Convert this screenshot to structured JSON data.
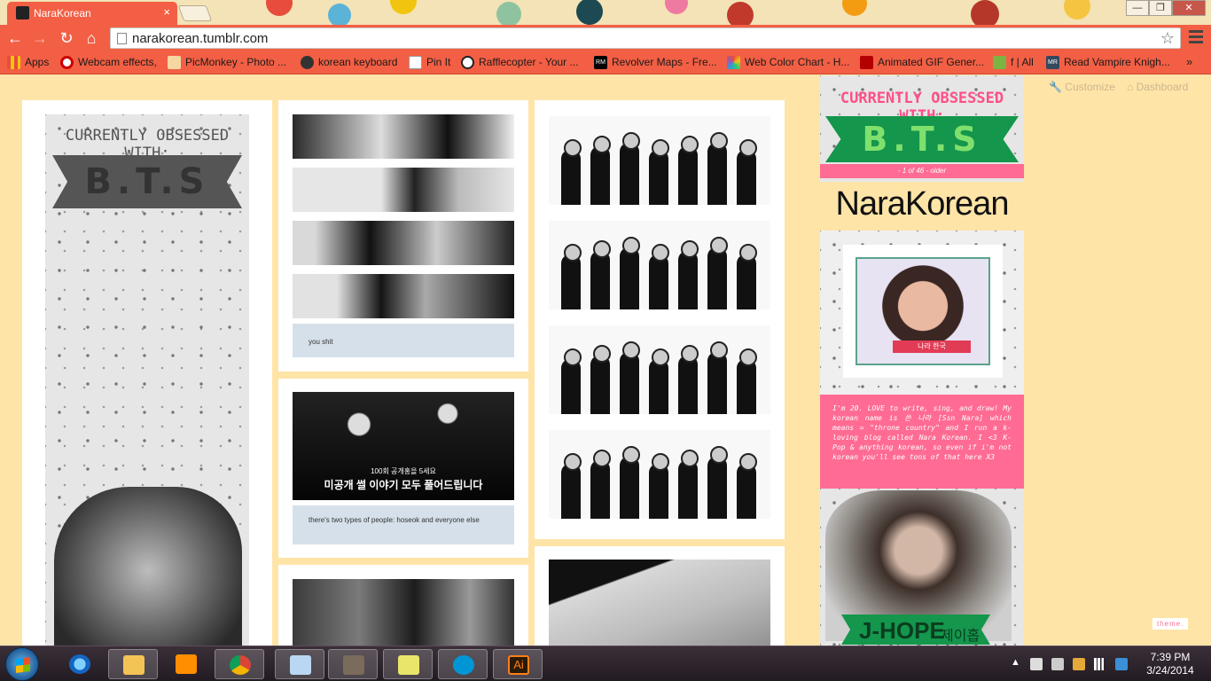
{
  "browser": {
    "tab_title": "NaraKorean",
    "tab_close": "×",
    "url": "narakorean.tumblr.com",
    "window_controls": [
      "—",
      "❐",
      "✕"
    ],
    "nav": {
      "back": "←",
      "forward": "→",
      "reload": "↻",
      "home": "⌂"
    },
    "bookmarks": [
      {
        "label": "Apps",
        "color": "#d9534f"
      },
      {
        "label": "Webcam effects,",
        "color": "#c00000"
      },
      {
        "label": "PicMonkey - Photo ...",
        "color": "#e8a33b"
      },
      {
        "label": "korean keyboard",
        "color": "#333333"
      },
      {
        "label": "Pin It",
        "color": "#ffffff"
      },
      {
        "label": "Rafflecopter - Your ...",
        "color": "#222222"
      },
      {
        "label": "Revolver Maps - Fre...",
        "color": "#000000"
      },
      {
        "label": "Web Color Chart - H...",
        "color": "#8e44ad"
      },
      {
        "label": "Animated GIF Gener...",
        "color": "#b30000"
      },
      {
        "label": "f | All",
        "color": "#7cb342"
      },
      {
        "label": "Read Vampire Knigh...",
        "color": "#34495e"
      }
    ],
    "bookmarks_overflow": "»"
  },
  "post_column_1": {
    "header": "CURRENTLY OBSESSED WITH:",
    "banner": "B.T.S"
  },
  "post_column_2": {
    "caption_1": "you shit",
    "gif_subtitle_1": "100회 공개홍을 5세요",
    "gif_subtitle_2": "미공개 썰 이야기 모두 풀어드립니다",
    "caption_2": "there's two types of people: hoseok and everyone else"
  },
  "sidebar": {
    "customize": "Customize",
    "dashboard": "Dashboard",
    "header": "CURRENTLY OBSESSED WITH:",
    "banner": "B.T.S",
    "pager": "- 1 of 46 - older",
    "blog_title": "NaraKorean",
    "avatar_tag": "나라 한국",
    "description": "I'm 20. LOVE to write, sing, and draw! My korean name is 쓴 나라 [Ssn Nara] which means = \"throne country\" and I run a k-loving blog called Nara Korean. I <3 K-Pop & anything korean, so even if i'm not korean you'll see tons of that here X3",
    "bottom_banner": "J-HOPE",
    "bottom_banner_korean": "제이홉",
    "theme_link": "theme."
  },
  "taskbar": {
    "time": "7:39 PM",
    "date": "3/24/2014",
    "tray_arrow": "▲"
  }
}
